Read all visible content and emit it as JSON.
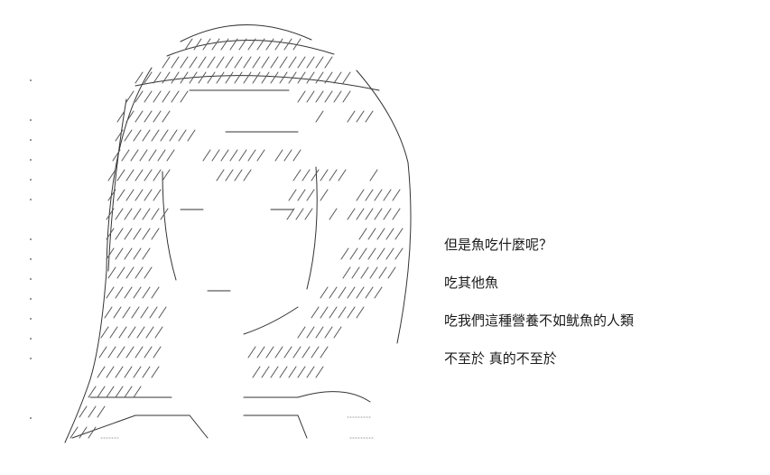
{
  "dialogue": {
    "lines": [
      "但是魚吃什麼呢？",
      "吃其他魚",
      "吃我們這種營養不如鱿魚的人類",
      "不至於 真的不至於"
    ]
  },
  "art": {
    "kind": "ascii-art-character",
    "stroke_color": "#333333"
  }
}
